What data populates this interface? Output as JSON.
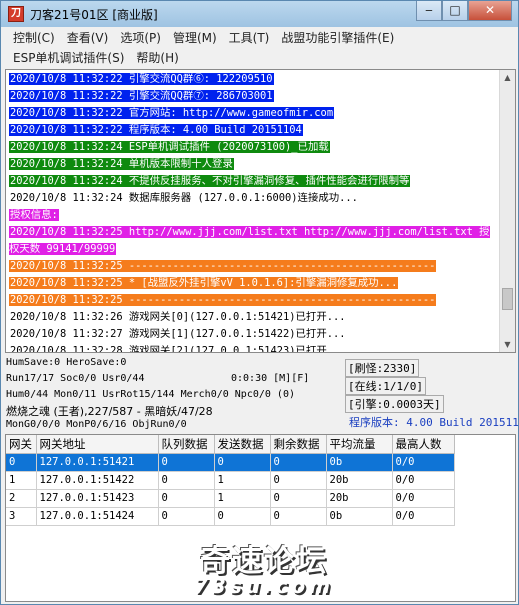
{
  "window": {
    "icon_glyph": "刀",
    "title": "刀客21号01区 [商业版]"
  },
  "menu": {
    "row1": [
      "控制(C)",
      "查看(V)",
      "选项(P)",
      "管理(M)",
      "工具(T)",
      "战盟功能引擎插件(E)"
    ],
    "row2": [
      "ESP单机调试插件(S)",
      "帮助(H)"
    ]
  },
  "log": {
    "lines": [
      {
        "text": "2020/10/8 11:32:22 引擎交流QQ群⑥: 122209510",
        "style": "blue"
      },
      {
        "text": "2020/10/8 11:32:22 引擎交流QQ群⑦: 286703001",
        "style": "blue"
      },
      {
        "text": "2020/10/8 11:32:22 官方网站: http://www.gameofmir.com",
        "style": "blue"
      },
      {
        "text": "2020/10/8 11:32:22 程序版本: 4.00 Build 20151104",
        "style": "blue"
      },
      {
        "text": "2020/10/8 11:32:24 ESP单机调试插件 (2020073100)_已加载",
        "style": "green"
      },
      {
        "text": "2020/10/8 11:32:24 单机版本限制十人登录",
        "style": "green"
      },
      {
        "text": "2020/10/8 11:32:24 不提供反挂服务、不对引擎漏洞修复、插件性能会进行限制等",
        "style": "green"
      },
      {
        "text": "2020/10/8 11:32:24 数据库服务器 (127.0.0.1:6000)连接成功...",
        "style": "plain"
      },
      {
        "text": "授权信息:",
        "style": "mag"
      },
      {
        "text": "2020/10/8 11:32:25 http://www.jjj.com/list.txt http://www.jjj.com/list.txt 授权天数 99141/99999",
        "style": "mag-wrap"
      },
      {
        "text": "2020/10/8 11:32:25 -------------------------------------------------",
        "style": "orange"
      },
      {
        "text": "2020/10/8 11:32:25 * [战盟反外挂引擎vV 1.0.1.6]:引擎漏洞修复成功...",
        "style": "orange"
      },
      {
        "text": "2020/10/8 11:32:25 -------------------------------------------------",
        "style": "orange"
      },
      {
        "text": "2020/10/8 11:32:26 游戏网关[0](127.0.0.1:51421)已打开...",
        "style": "plain"
      },
      {
        "text": "2020/10/8 11:32:27 游戏网关[1](127.0.0.1:51422)已打开...",
        "style": "plain"
      },
      {
        "text": "2020/10/8 11:32:28 游戏网关[2](127.0.0.1:51423)已打开...",
        "style": "plain"
      },
      {
        "text": "2020/10/8 11:32:30 游戏网关[3](127.0.0.1:51424)已打开...",
        "style": "plain"
      }
    ]
  },
  "status": {
    "hum_save": "HumSave:0 HeroSave:0",
    "run": "Run17/17 Soc0/0 Usr0/44",
    "timer": "0:0:30 [M][F]",
    "hum": "Hum0/44 Mon0/11 UsrRot15/144 Merch0/0 Npc0/0 (0)",
    "city": "燃烧之魂 (王者),227/587 - 黑暗妖/47/28",
    "mon": "MonG0/0/0 MonP0/6/16 ObjRun0/0",
    "refresh": "[刷怪:2330]",
    "online": "[在线:1/1/0]",
    "engine": "[引擎:0.0003天]",
    "version": "程序版本: 4.00 Build 20151104"
  },
  "gateway_table": {
    "headers": [
      "网关",
      "网关地址",
      "队列数据",
      "发送数据",
      "剩余数据",
      "平均流量",
      "最高人数"
    ],
    "rows": [
      [
        "0",
        "127.0.0.1:51421",
        "0",
        "0",
        "0",
        "0b",
        "0/0"
      ],
      [
        "1",
        "127.0.0.1:51422",
        "0",
        "1",
        "0",
        "20b",
        "0/0"
      ],
      [
        "2",
        "127.0.0.1:51423",
        "0",
        "1",
        "0",
        "20b",
        "0/0"
      ],
      [
        "3",
        "127.0.0.1:51424",
        "0",
        "0",
        "0",
        "0b",
        "0/0"
      ]
    ]
  },
  "watermark": {
    "title": "奇速论坛",
    "sub": "73su.com"
  }
}
